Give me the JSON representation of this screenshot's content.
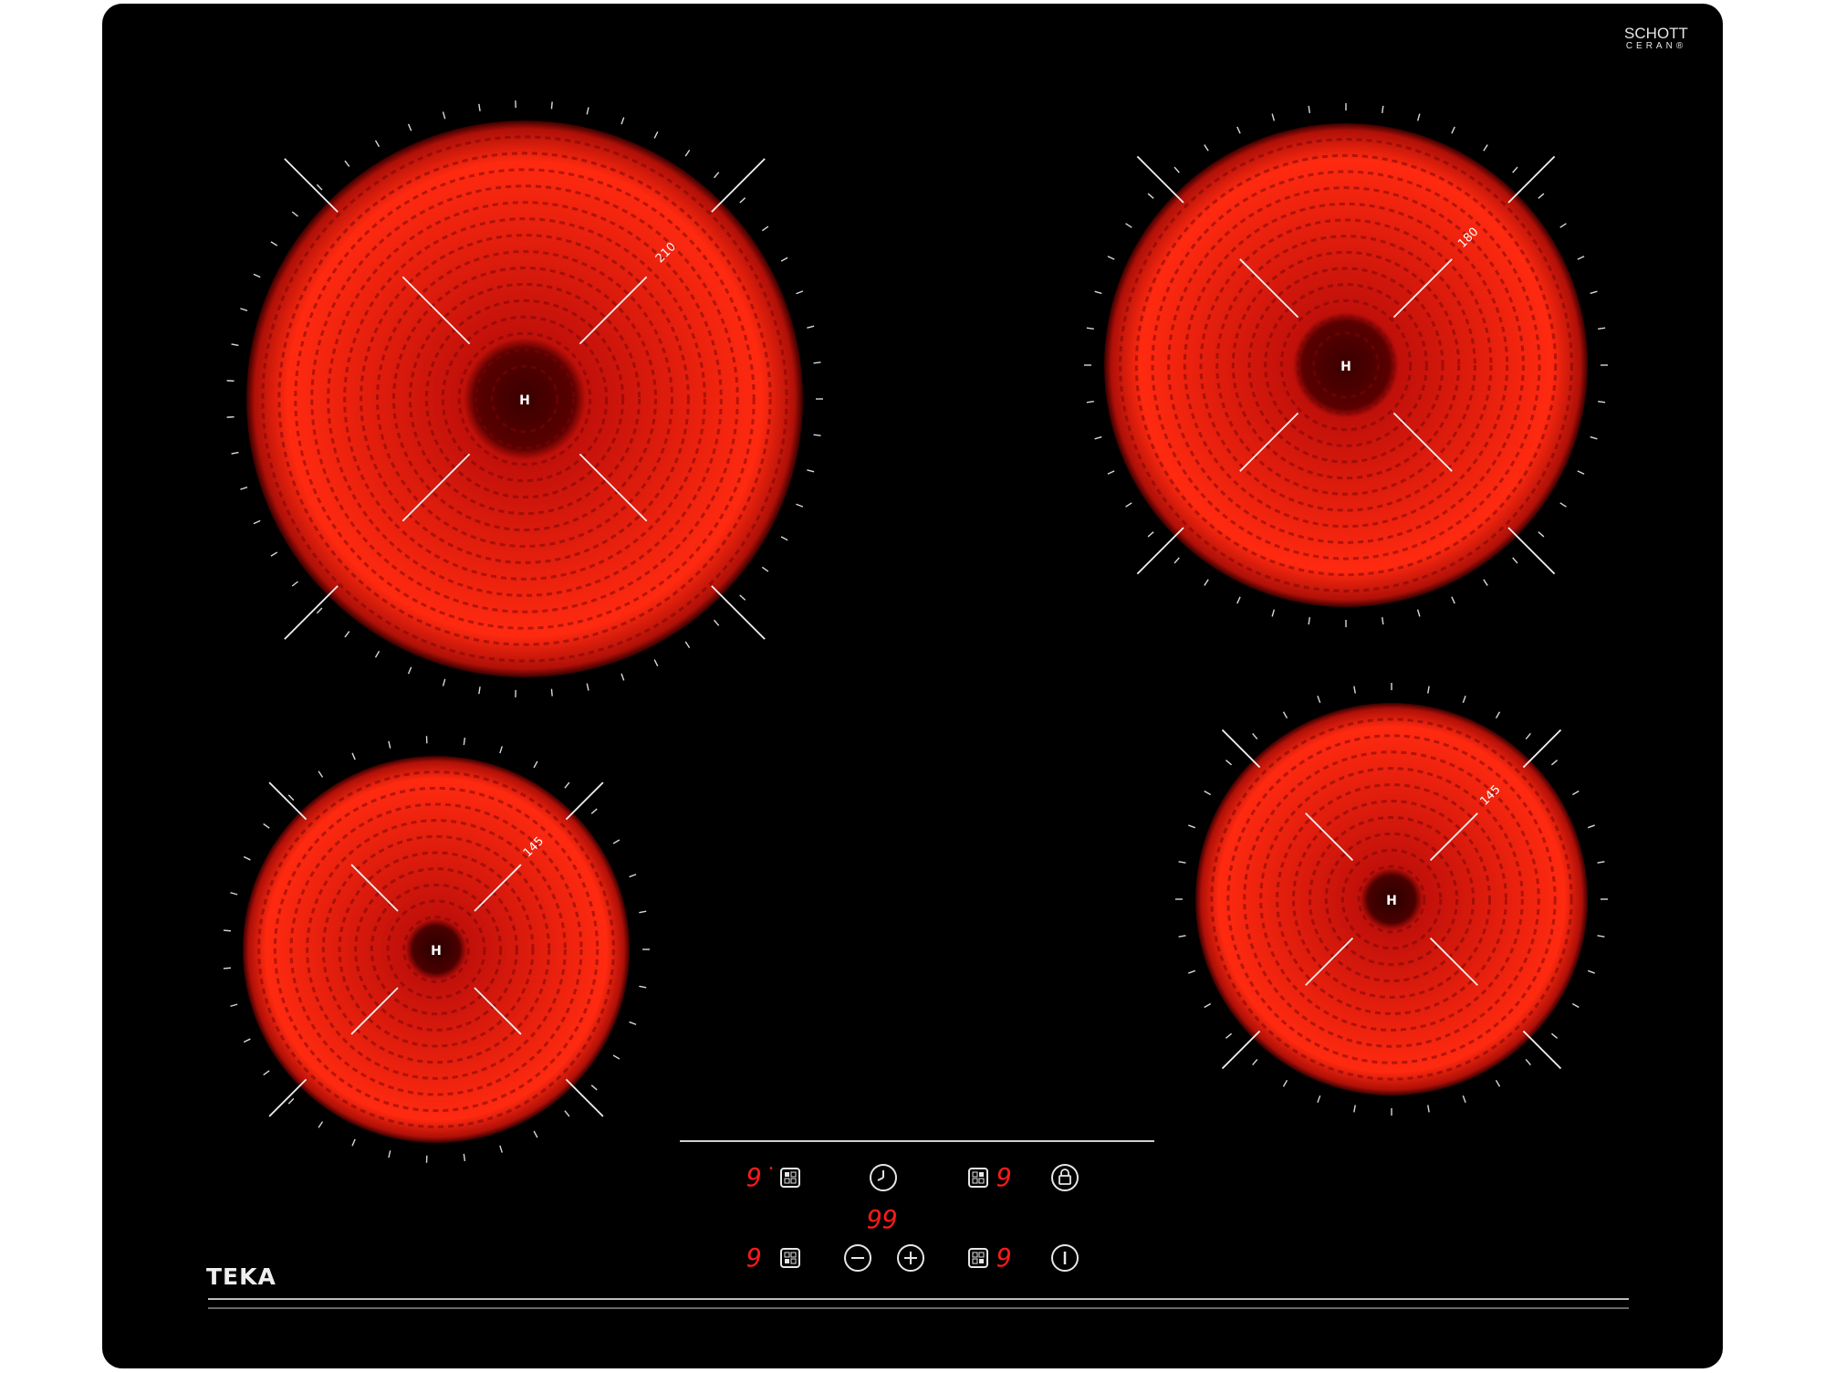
{
  "brand": {
    "logo": "TEKA",
    "certification_line1": "SCHOTT",
    "certification_line2": "CERAN®"
  },
  "colors": {
    "glass": "#000000",
    "heat_red": "#ff2a10",
    "display_red": "#ff1a1a",
    "markings": "#e6e6e6"
  },
  "zones": [
    {
      "id": "rear-left",
      "size_label": "210",
      "center_label": "H"
    },
    {
      "id": "rear-right",
      "size_label": "180",
      "center_label": "H"
    },
    {
      "id": "front-left",
      "size_label": "145",
      "center_label": "H"
    },
    {
      "id": "front-right",
      "size_label": "145",
      "center_label": "H"
    }
  ],
  "controls": {
    "rear_left_display": "9",
    "rear_right_display": "9",
    "front_left_display": "9",
    "front_right_display": "9",
    "timer_display": "99",
    "timer_icon": "clock-icon",
    "lock_icon": "lock-icon",
    "minus_label": "−",
    "plus_label": "+",
    "power_icon": "power-icon"
  }
}
